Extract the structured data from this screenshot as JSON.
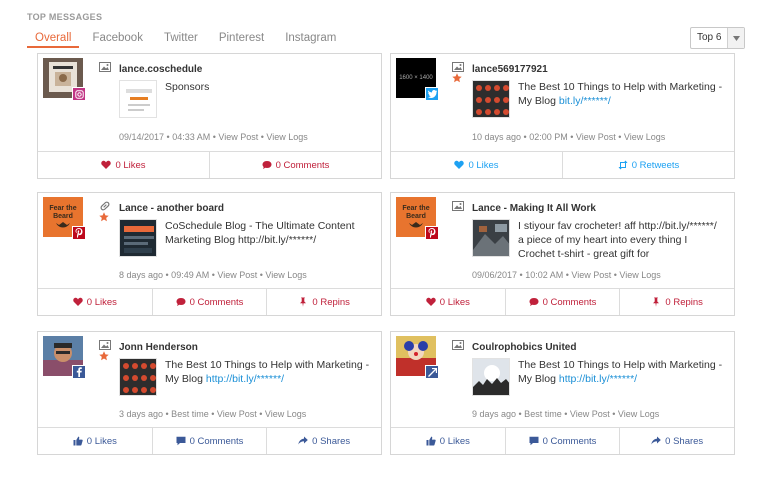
{
  "heading": "TOP MESSAGES",
  "tabs": [
    "Overall",
    "Facebook",
    "Twitter",
    "Pinterest",
    "Instagram"
  ],
  "dropdown": {
    "selected": "Top 6"
  },
  "colors": {
    "accent": "#e8693a",
    "pinterest": "#c0213b",
    "twitter": "#1da1f2",
    "facebook": "#3b5998",
    "link": "#1a8fd6"
  },
  "cards": [
    {
      "network": "instagram",
      "type_icon": "image-icon",
      "starred": false,
      "author": "lance.coschedule",
      "message": "Sponsors",
      "meta": "09/14/2017 • 04:33 AM • View Post • View Logs",
      "actions": [
        {
          "icon": "heart-icon",
          "label": "0 Likes"
        },
        {
          "icon": "comment-icon",
          "label": "0 Comments"
        }
      ]
    },
    {
      "network": "twitter",
      "type_icon": "image-icon",
      "starred": true,
      "author": "lance569177921",
      "avatar_text": "1600 × 1400",
      "message_prefix": "The Best 10 Things to Help with Marketing - My Blog ",
      "message_link": "bit.ly/******/",
      "meta": "10 days ago • 02:00 PM • View Post • View Logs",
      "actions": [
        {
          "icon": "heart-icon",
          "label": "0 Likes"
        },
        {
          "icon": "retweet-icon",
          "label": "0 Retweets"
        }
      ]
    },
    {
      "network": "pinterest",
      "type_icon": "link-icon",
      "starred": true,
      "author": "Lance - another board",
      "avatar_text": "Fear the Beard",
      "message_prefix": "CoSchedule Blog - The Ultimate Content Marketing Blog ",
      "message_link": "http://bit.ly/******/",
      "meta": "8 days ago • 09:49 AM • View Post • View Logs",
      "actions": [
        {
          "icon": "heart-icon",
          "label": "0 Likes"
        },
        {
          "icon": "comment-icon",
          "label": "0 Comments"
        },
        {
          "icon": "pin-icon",
          "label": "0 Repins"
        }
      ]
    },
    {
      "network": "pinterest",
      "type_icon": "image-icon",
      "starred": false,
      "author": "Lance - Making It All Work",
      "avatar_text": "Fear the Beard",
      "message_prefix": "I stiyour fav crocheter! aff http://bit.ly/******/ a piece of my heart into every thing I Crochet t-shirt - great gift for",
      "message_link": "",
      "meta": "09/06/2017 • 10:02 AM • View Post • View Logs",
      "actions": [
        {
          "icon": "heart-icon",
          "label": "0 Likes"
        },
        {
          "icon": "comment-icon",
          "label": "0 Comments"
        },
        {
          "icon": "pin-icon",
          "label": "0 Repins"
        }
      ]
    },
    {
      "network": "facebook",
      "type_icon": "image-icon",
      "starred": true,
      "author": "Jonn Henderson",
      "message_prefix": "The Best 10 Things to Help with Marketing - My Blog ",
      "message_link": "http://bit.ly/******/",
      "meta": "3 days ago • Best time • View Post • View Logs",
      "actions": [
        {
          "icon": "thumbs-up-icon",
          "label": "0 Likes"
        },
        {
          "icon": "comment-icon",
          "label": "0 Comments"
        },
        {
          "icon": "share-icon",
          "label": "0 Shares"
        }
      ]
    },
    {
      "network": "facebook",
      "type_icon": "image-icon",
      "starred": false,
      "author": "Coulrophobics United",
      "message_prefix": "The Best 10 Things to Help with Marketing - My Blog ",
      "message_link": "http://bit.ly/******/",
      "meta": "9 days ago • Best time • View Post • View Logs",
      "actions": [
        {
          "icon": "thumbs-up-icon",
          "label": "0 Likes"
        },
        {
          "icon": "comment-icon",
          "label": "0 Comments"
        },
        {
          "icon": "share-icon",
          "label": "0 Shares"
        }
      ]
    }
  ]
}
